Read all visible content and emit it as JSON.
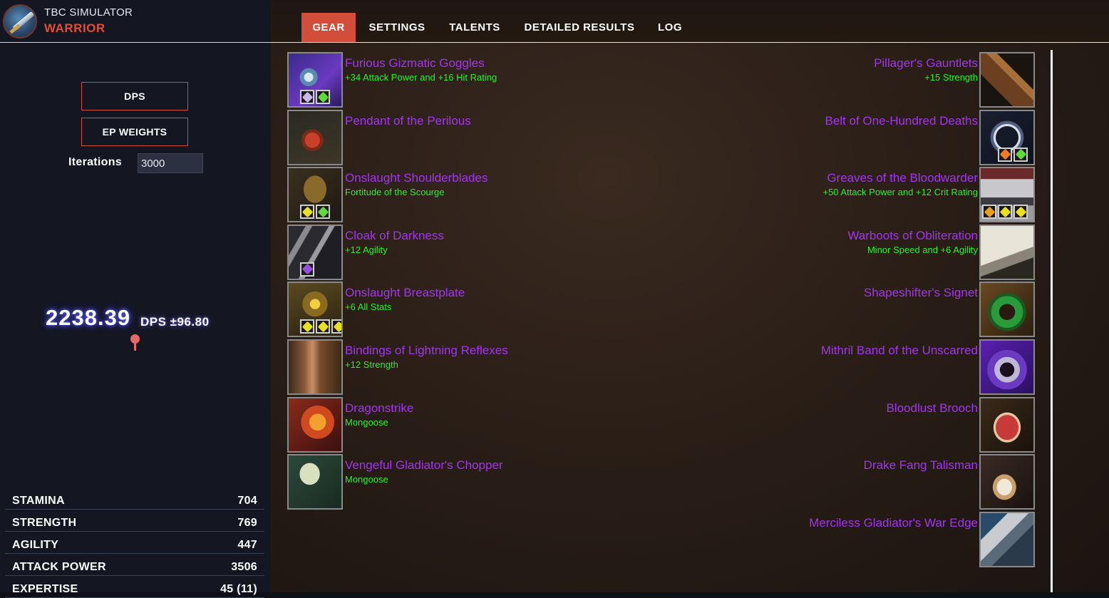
{
  "app": {
    "title": "TBC SIMULATOR",
    "class_name": "WARRIOR"
  },
  "sidebar": {
    "dps_button": "DPS",
    "ep_button": "EP WEIGHTS",
    "iterations_label": "Iterations",
    "iterations_value": "3000",
    "dps_result": "2238.39",
    "dps_stddev": "DPS ±96.80",
    "stats": [
      {
        "name": "STAMINA",
        "value": "704"
      },
      {
        "name": "STRENGTH",
        "value": "769"
      },
      {
        "name": "AGILITY",
        "value": "447"
      },
      {
        "name": "ATTACK POWER",
        "value": "3506"
      },
      {
        "name": "EXPERTISE",
        "value": "45 (11)"
      }
    ]
  },
  "tabs": [
    {
      "label": "GEAR",
      "active": true
    },
    {
      "label": "SETTINGS",
      "active": false
    },
    {
      "label": "TALENTS",
      "active": false
    },
    {
      "label": "DETAILED RESULTS",
      "active": false
    },
    {
      "label": "LOG",
      "active": false
    }
  ],
  "colors": {
    "accent": "#d24e3b",
    "item_epic": "#a335ee",
    "enchant": "#2bef2b",
    "class_text": "#e24e35"
  },
  "gear_left": [
    {
      "name": "Furious Gizmatic Goggles",
      "enchant": "+34 Attack Power and +16 Hit Rating",
      "icon": "goggles-icon",
      "gems": [
        "#c8b6e8",
        "#5fd83a"
      ]
    },
    {
      "name": "Pendant of the Perilous",
      "enchant": "",
      "icon": "pendant-icon",
      "gems": []
    },
    {
      "name": "Onslaught Shoulderblades",
      "enchant": "Fortitude of the Scourge",
      "icon": "shoulders-icon",
      "gems": [
        "#e8e020",
        "#5fd83a"
      ]
    },
    {
      "name": "Cloak of Darkness",
      "enchant": "+12 Agility",
      "icon": "cloak-icon",
      "gems": [
        "#9a4ce8"
      ]
    },
    {
      "name": "Onslaught Breastplate",
      "enchant": "+6 All Stats",
      "icon": "chest-icon",
      "gems": [
        "#e8e020",
        "#e8e020",
        "#e8e020"
      ]
    },
    {
      "name": "Bindings of Lightning Reflexes",
      "enchant": "+12 Strength",
      "icon": "bracers-icon",
      "gems": []
    },
    {
      "name": "Dragonstrike",
      "enchant": "Mongoose",
      "icon": "dragon-sword-icon",
      "gems": []
    },
    {
      "name": "Vengeful Gladiator's Chopper",
      "enchant": "Mongoose",
      "icon": "axe-icon",
      "gems": []
    }
  ],
  "gear_right": [
    {
      "name": "Pillager's Gauntlets",
      "enchant": "+15 Strength",
      "icon": "gauntlets-icon",
      "gems": []
    },
    {
      "name": "Belt of One-Hundred Deaths",
      "enchant": "",
      "icon": "belt-icon",
      "gems": [
        "#f07a20",
        "#5fd83a"
      ]
    },
    {
      "name": "Greaves of the Bloodwarder",
      "enchant": "+50 Attack Power and +12 Crit Rating",
      "icon": "legs-icon",
      "gems": [
        "#e8a020",
        "#e8e020",
        "#e8e020"
      ]
    },
    {
      "name": "Warboots of Obliteration",
      "enchant": "Minor Speed and +6 Agility",
      "icon": "boots-icon",
      "gems": []
    },
    {
      "name": "Shapeshifter's Signet",
      "enchant": "",
      "icon": "ring-green-icon",
      "gems": []
    },
    {
      "name": "Mithril Band of the Unscarred",
      "enchant": "",
      "icon": "ring-purple-icon",
      "gems": []
    },
    {
      "name": "Bloodlust Brooch",
      "enchant": "",
      "icon": "brooch-icon",
      "gems": []
    },
    {
      "name": "Drake Fang Talisman",
      "enchant": "",
      "icon": "fang-icon",
      "gems": []
    },
    {
      "name": "Merciless Gladiator's War Edge",
      "enchant": "",
      "icon": "thrown-icon",
      "gems": []
    }
  ]
}
